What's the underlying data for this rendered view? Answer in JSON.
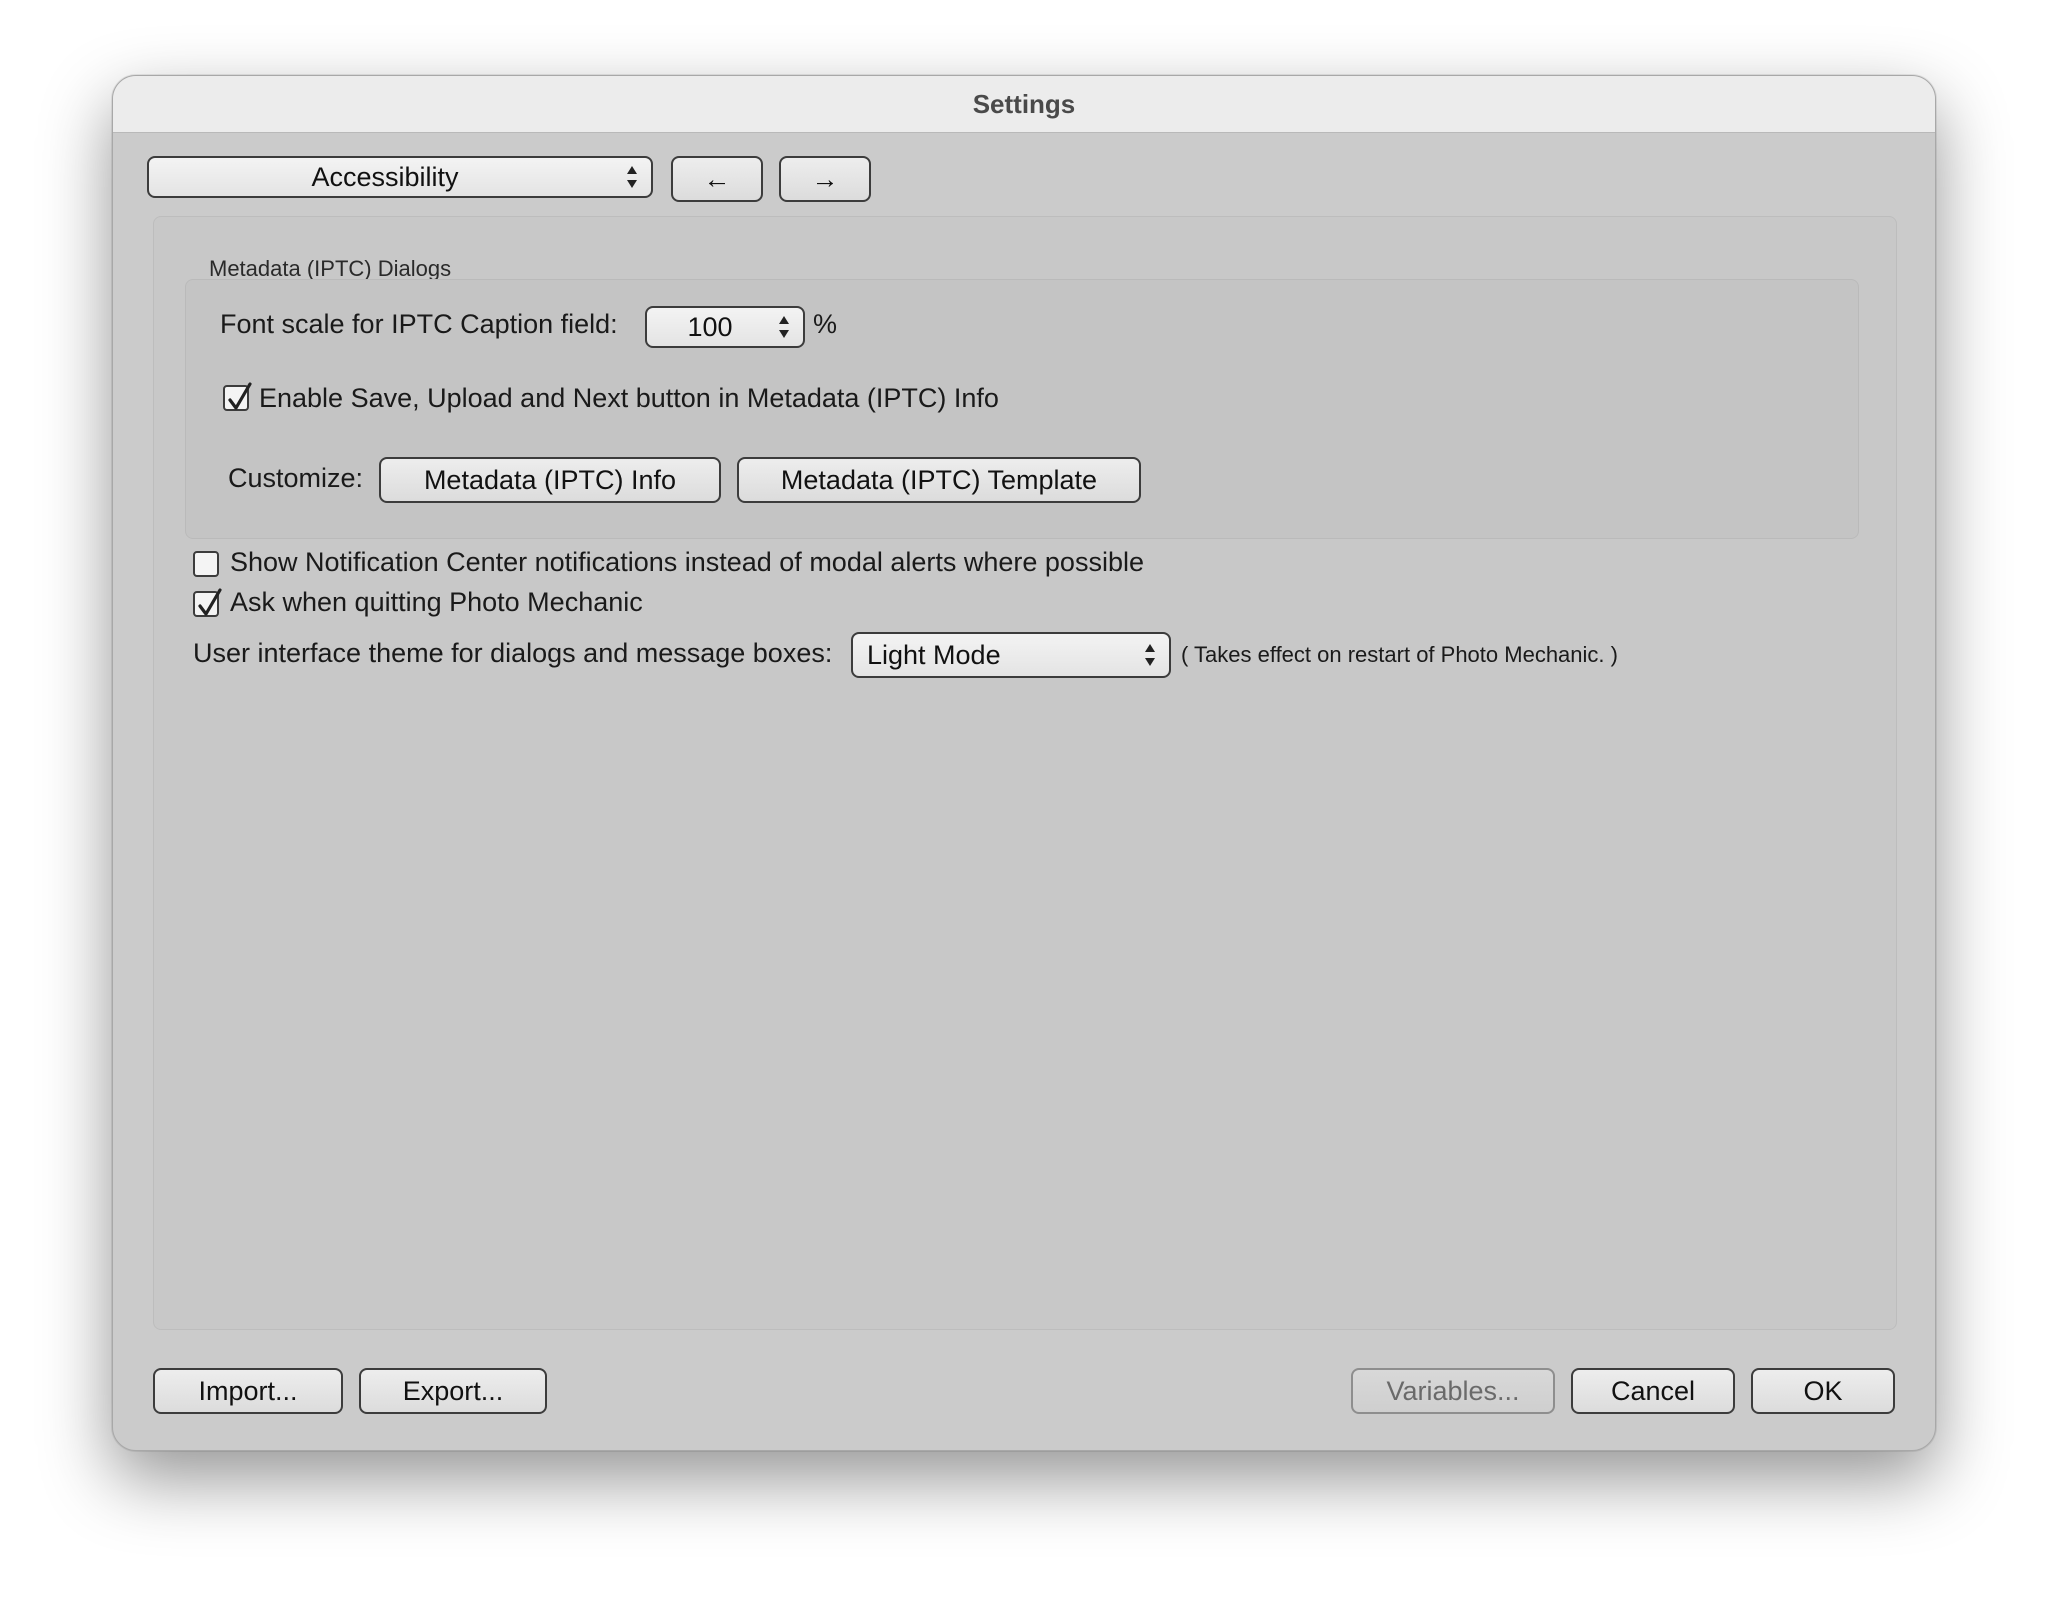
{
  "window": {
    "title": "Settings"
  },
  "toolbar": {
    "category": "Accessibility",
    "prev_label": "←",
    "next_label": "→"
  },
  "group": {
    "title": "Metadata (IPTC) Dialogs",
    "font_scale_label": "Font scale for IPTC Caption field:",
    "font_scale_value": "100",
    "font_scale_unit": "%",
    "enable_save_label": "Enable Save, Upload and Next button in Metadata (IPTC) Info",
    "enable_save_checked": true,
    "customize_label": "Customize:",
    "info_button": "Metadata (IPTC) Info",
    "template_button": "Metadata (IPTC) Template"
  },
  "options": {
    "notification_label": "Show Notification Center notifications instead of modal alerts where possible",
    "notification_checked": false,
    "ask_quit_label": "Ask when quitting Photo Mechanic",
    "ask_quit_checked": true,
    "theme_label": "User interface theme for dialogs and message boxes:",
    "theme_value": "Light Mode",
    "theme_note": "( Takes effect on restart of Photo Mechanic. )"
  },
  "footer": {
    "import_label": "Import...",
    "export_label": "Export...",
    "variables_label": "Variables...",
    "cancel_label": "Cancel",
    "ok_label": "OK"
  },
  "icons": {
    "stepper": "up-down-stepper-icon",
    "check": "checkmark-icon"
  }
}
